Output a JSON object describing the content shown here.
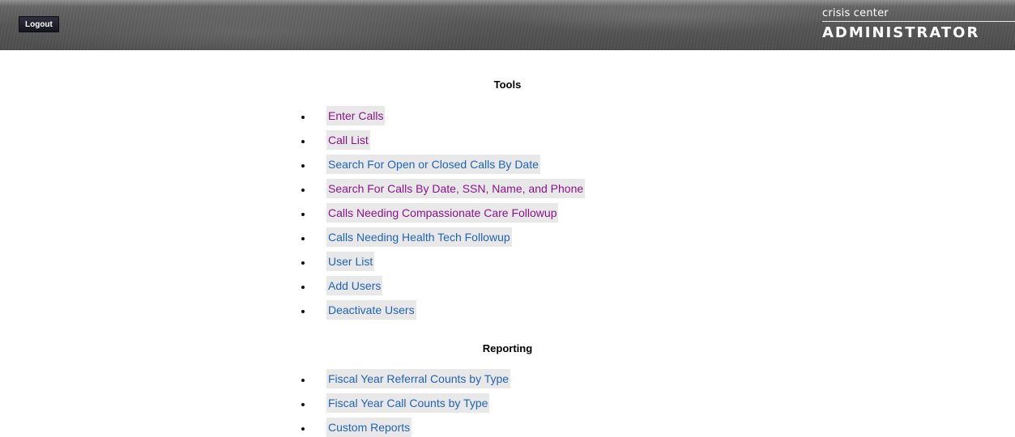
{
  "header": {
    "logout_label": "Logout",
    "brand_top": "crisis center",
    "brand_bottom": "ADMINISTRATOR"
  },
  "tools": {
    "title": "Tools",
    "items": [
      {
        "label": "Enter Calls",
        "visited": true
      },
      {
        "label": "Call List",
        "visited": true
      },
      {
        "label": "Search For Open or Closed Calls By Date",
        "visited": false
      },
      {
        "label": "Search For Calls By Date, SSN, Name, and Phone",
        "visited": true
      },
      {
        "label": "Calls Needing Compassionate Care Followup",
        "visited": true
      },
      {
        "label": "Calls Needing Health Tech Followup",
        "visited": false
      },
      {
        "label": "User List",
        "visited": false
      },
      {
        "label": "Add Users",
        "visited": false
      },
      {
        "label": "Deactivate Users",
        "visited": false
      }
    ]
  },
  "reporting": {
    "title": "Reporting",
    "items": [
      {
        "label": "Fiscal Year Referral Counts by Type",
        "visited": false
      },
      {
        "label": "Fiscal Year Call Counts by Type",
        "visited": false
      },
      {
        "label": "Custom Reports",
        "visited": false
      }
    ]
  },
  "colors": {
    "link_visited": "#8a158a",
    "link_unvisited": "#1f63b6",
    "link_bg": "#e8e8e8",
    "header_bg": "#5a5a5a"
  }
}
